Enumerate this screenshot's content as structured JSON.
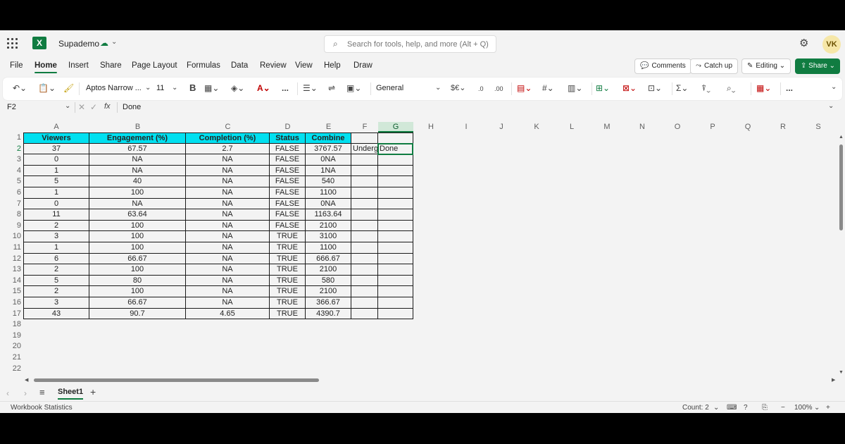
{
  "title_bar": {
    "doc_name": "Supademo",
    "search_placeholder": "Search for tools, help, and more (Alt + Q)",
    "avatar_initials": "VK"
  },
  "menu": {
    "tabs": [
      "File",
      "Home",
      "Insert",
      "Share",
      "Page Layout",
      "Formulas",
      "Data",
      "Review",
      "View",
      "Help",
      "Draw"
    ],
    "active_tab": "Home",
    "comments": "Comments",
    "catch_up": "Catch up",
    "editing": "Editing",
    "share": "Share"
  },
  "ribbon": {
    "font_name": "Aptos Narrow ...",
    "font_size": "11",
    "number_format": "General",
    "bold": "B",
    "currency": "$€",
    "decimals_down": ".0",
    "decimals_up": ".00",
    "more": "..."
  },
  "formula_bar": {
    "name_box": "F2",
    "fx": "fx",
    "formula": "Done"
  },
  "columns": [
    "A",
    "B",
    "C",
    "D",
    "E",
    "F",
    "G",
    "H",
    "I",
    "J",
    "K",
    "L",
    "M",
    "N",
    "O",
    "P",
    "Q",
    "R",
    "S"
  ],
  "rows": [
    "1",
    "2",
    "3",
    "4",
    "5",
    "6",
    "7",
    "8",
    "9",
    "10",
    "11",
    "12",
    "13",
    "14",
    "15",
    "16",
    "17",
    "18",
    "19",
    "20",
    "21",
    "22"
  ],
  "table": {
    "headers": [
      "Viewers",
      "Engagement (%)",
      "Completion (%)",
      "Status",
      "Combine"
    ],
    "data": [
      [
        "37",
        "67.57",
        "2.7",
        "FALSE",
        "3767.57"
      ],
      [
        "0",
        "NA",
        "NA",
        "FALSE",
        "0NA"
      ],
      [
        "1",
        "NA",
        "NA",
        "FALSE",
        "1NA"
      ],
      [
        "5",
        "40",
        "NA",
        "FALSE",
        "540"
      ],
      [
        "1",
        "100",
        "NA",
        "FALSE",
        "1100"
      ],
      [
        "0",
        "NA",
        "NA",
        "FALSE",
        "0NA"
      ],
      [
        "11",
        "63.64",
        "NA",
        "FALSE",
        "1163.64"
      ],
      [
        "2",
        "100",
        "NA",
        "FALSE",
        "2100"
      ],
      [
        "3",
        "100",
        "NA",
        "TRUE",
        "3100"
      ],
      [
        "1",
        "100",
        "NA",
        "TRUE",
        "1100"
      ],
      [
        "6",
        "66.67",
        "NA",
        "TRUE",
        "666.67"
      ],
      [
        "2",
        "100",
        "NA",
        "TRUE",
        "2100"
      ],
      [
        "5",
        "80",
        "NA",
        "TRUE",
        "580"
      ],
      [
        "2",
        "100",
        "NA",
        "TRUE",
        "2100"
      ],
      [
        "3",
        "66.67",
        "NA",
        "TRUE",
        "366.67"
      ],
      [
        "43",
        "90.7",
        "4.65",
        "TRUE",
        "4390.7"
      ]
    ],
    "f2": "Underg",
    "g2": "Done"
  },
  "sheets": [
    "Sheet1"
  ],
  "status_bar": {
    "left": "Workbook Statistics",
    "count": "Count: 2",
    "zoom": "100%"
  },
  "colors": {
    "accent": "#107c41",
    "header_fill": "#00e0f0"
  }
}
